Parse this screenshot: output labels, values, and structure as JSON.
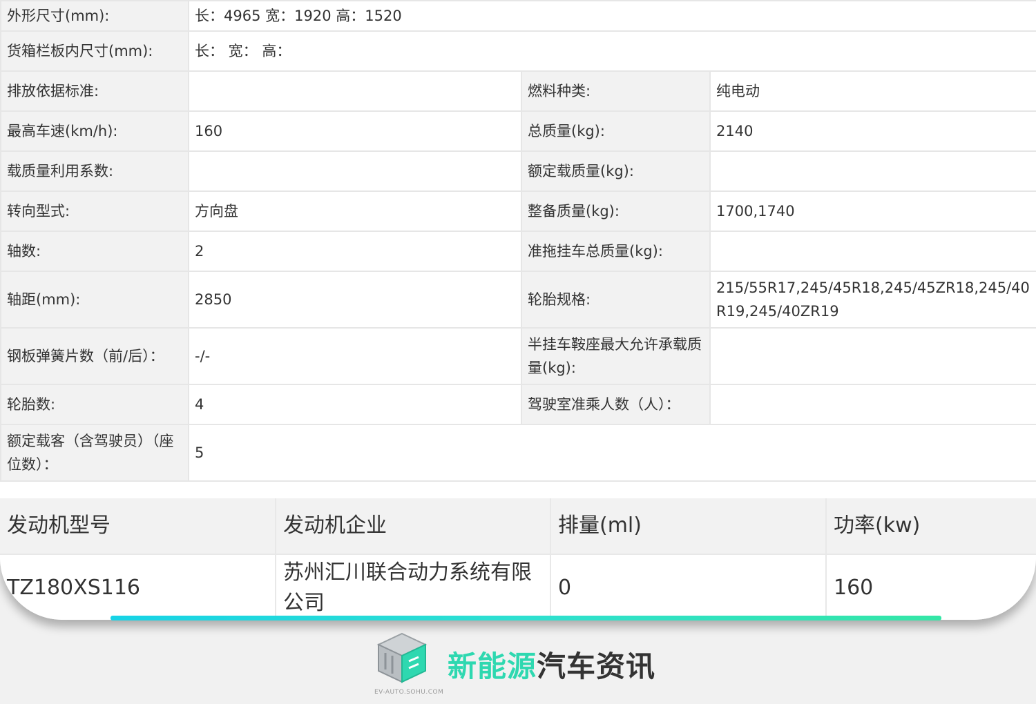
{
  "specs": {
    "dim_label": "外形尺寸(mm):",
    "dim_value": "长：4965 宽：1920 高：1520",
    "cargo_label": "货箱栏板内尺寸(mm):",
    "cargo_value": "长：  宽：  高：",
    "rows": [
      {
        "l1": "排放依据标准:",
        "v1": "",
        "l2": "燃料种类:",
        "v2": "纯电动"
      },
      {
        "l1": "最高车速(km/h):",
        "v1": "160",
        "l2": "总质量(kg):",
        "v2": "2140"
      },
      {
        "l1": "载质量利用系数:",
        "v1": "",
        "l2": "额定载质量(kg):",
        "v2": ""
      },
      {
        "l1": "转向型式:",
        "v1": "方向盘",
        "l2": "整备质量(kg):",
        "v2": "1700,1740"
      },
      {
        "l1": "轴数:",
        "v1": "2",
        "l2": "准拖挂车总质量(kg):",
        "v2": ""
      },
      {
        "l1": "轴距(mm):",
        "v1": "2850",
        "l2": "轮胎规格:",
        "v2": "215/55R17,245/45R18,245/45ZR18,245/40R19,245/40ZR19"
      },
      {
        "l1": "钢板弹簧片数（前/后）：",
        "v1": "-/-",
        "l2": "半挂车鞍座最大允许承载质量(kg):",
        "v2": ""
      },
      {
        "l1": "轮胎数:",
        "v1": "4",
        "l2": "驾驶室准乘人数（人）：",
        "v2": ""
      }
    ],
    "passenger_label": "额定载客（含驾驶员）（座位数）：",
    "passenger_value": "5"
  },
  "engine": {
    "headers": [
      "发动机型号",
      "发动机企业",
      "排量(ml)",
      "功率(kw)"
    ],
    "row": [
      "TZ180XS116",
      "苏州汇川联合动力系统有限公司",
      "0",
      "160"
    ]
  },
  "logo": {
    "name_green": "新能源",
    "name_dark": "汽车资讯",
    "url": "EV-AUTO.SOHU.COM",
    "icon": "cube-logo-icon"
  },
  "colors": {
    "accent": "#2ed8b0",
    "label_bg": "#f2f2f2",
    "border": "#e6e6e6"
  }
}
